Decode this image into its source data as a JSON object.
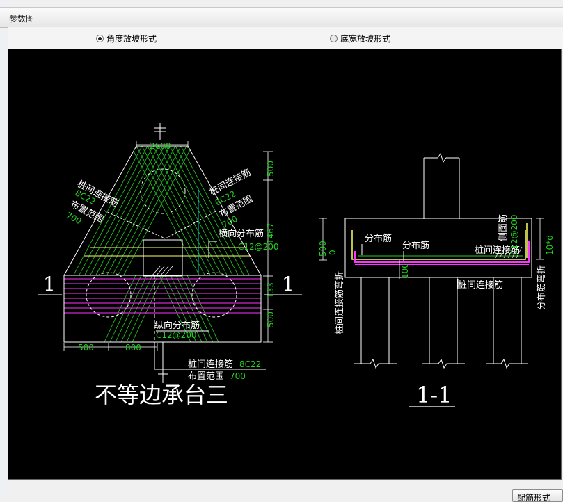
{
  "window": {
    "title": "参数图"
  },
  "options": {
    "angle_mode": {
      "label": "角度放坡形式",
      "checked": true
    },
    "width_mode": {
      "label": "底宽放坡形式",
      "checked": false
    }
  },
  "drawing": {
    "plan_title": "不等边承台三",
    "section_title": "1-1",
    "section_mark_left": "1",
    "section_mark_right": "1",
    "dim_top": "2600",
    "dim_bottom_left": "500",
    "dim_bottom_mid": "800",
    "dim_right_500_top": "500",
    "dim_right_1467": "1467",
    "dim_right_133": "133",
    "dim_right_500_bottom": "500",
    "left_link_label": "桩间连接筋",
    "left_link_spec": "8C22",
    "left_range_label": "布置范围",
    "left_range_value": "700",
    "right_link_label": "桩间连接筋",
    "right_link_spec": "8C22",
    "right_range_label": "布置范围",
    "right_range_value": "700",
    "transverse_label": "横向分布筋",
    "transverse_spec": "C12@200",
    "longitudinal_label": "纵向分布筋",
    "longitudinal_spec": "C12@200",
    "bottom_link_label": "桩间连接筋",
    "bottom_link_spec": "8C22",
    "bottom_range_label": "布置范围",
    "bottom_range_value": "700",
    "sec_dist1": "分布筋",
    "sec_dist2": "分布筋",
    "sec_link_top": "桩间连接筋",
    "sec_link_bottom": "桩间连接筋",
    "sec_left_vertical": "桩间连接筋弯折",
    "sec_side_bar": "侧面筋",
    "sec_side_spec": "C12@200",
    "sec_dim_500": "500",
    "sec_dim_0": "0",
    "sec_dim_100": "100",
    "sec_dim_10d": "10*d",
    "sec_right_vertical": "分布筋弯折"
  },
  "buttons": {
    "config": "配筋形式"
  },
  "colors": {
    "green": "#22d11f",
    "white": "#ffffff",
    "magenta": "#ff33ff",
    "yellow": "#ffff66",
    "cyan": "#00c8c8",
    "canvas": "#000000"
  }
}
